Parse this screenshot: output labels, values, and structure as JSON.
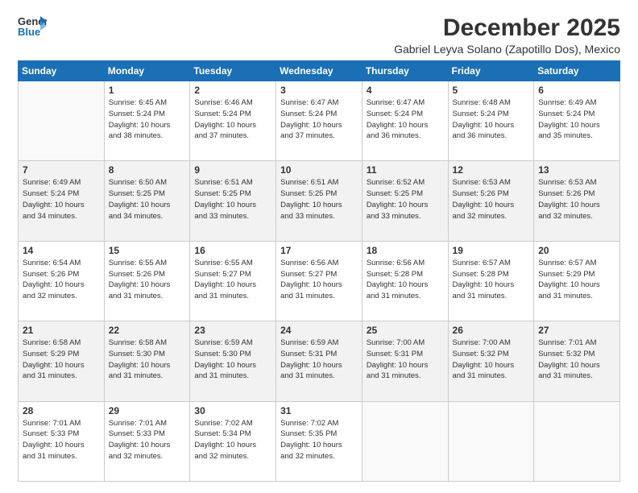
{
  "logo": {
    "line1": "General",
    "line2": "Blue"
  },
  "title": "December 2025",
  "subtitle": "Gabriel Leyva Solano (Zapotillo Dos), Mexico",
  "days_header": [
    "Sunday",
    "Monday",
    "Tuesday",
    "Wednesday",
    "Thursday",
    "Friday",
    "Saturday"
  ],
  "weeks": [
    [
      {
        "num": "",
        "info": ""
      },
      {
        "num": "1",
        "info": "Sunrise: 6:45 AM\nSunset: 5:24 PM\nDaylight: 10 hours\nand 38 minutes."
      },
      {
        "num": "2",
        "info": "Sunrise: 6:46 AM\nSunset: 5:24 PM\nDaylight: 10 hours\nand 37 minutes."
      },
      {
        "num": "3",
        "info": "Sunrise: 6:47 AM\nSunset: 5:24 PM\nDaylight: 10 hours\nand 37 minutes."
      },
      {
        "num": "4",
        "info": "Sunrise: 6:47 AM\nSunset: 5:24 PM\nDaylight: 10 hours\nand 36 minutes."
      },
      {
        "num": "5",
        "info": "Sunrise: 6:48 AM\nSunset: 5:24 PM\nDaylight: 10 hours\nand 36 minutes."
      },
      {
        "num": "6",
        "info": "Sunrise: 6:49 AM\nSunset: 5:24 PM\nDaylight: 10 hours\nand 35 minutes."
      }
    ],
    [
      {
        "num": "7",
        "info": "Sunrise: 6:49 AM\nSunset: 5:24 PM\nDaylight: 10 hours\nand 34 minutes."
      },
      {
        "num": "8",
        "info": "Sunrise: 6:50 AM\nSunset: 5:25 PM\nDaylight: 10 hours\nand 34 minutes."
      },
      {
        "num": "9",
        "info": "Sunrise: 6:51 AM\nSunset: 5:25 PM\nDaylight: 10 hours\nand 33 minutes."
      },
      {
        "num": "10",
        "info": "Sunrise: 6:51 AM\nSunset: 5:25 PM\nDaylight: 10 hours\nand 33 minutes."
      },
      {
        "num": "11",
        "info": "Sunrise: 6:52 AM\nSunset: 5:25 PM\nDaylight: 10 hours\nand 33 minutes."
      },
      {
        "num": "12",
        "info": "Sunrise: 6:53 AM\nSunset: 5:26 PM\nDaylight: 10 hours\nand 32 minutes."
      },
      {
        "num": "13",
        "info": "Sunrise: 6:53 AM\nSunset: 5:26 PM\nDaylight: 10 hours\nand 32 minutes."
      }
    ],
    [
      {
        "num": "14",
        "info": "Sunrise: 6:54 AM\nSunset: 5:26 PM\nDaylight: 10 hours\nand 32 minutes."
      },
      {
        "num": "15",
        "info": "Sunrise: 6:55 AM\nSunset: 5:26 PM\nDaylight: 10 hours\nand 31 minutes."
      },
      {
        "num": "16",
        "info": "Sunrise: 6:55 AM\nSunset: 5:27 PM\nDaylight: 10 hours\nand 31 minutes."
      },
      {
        "num": "17",
        "info": "Sunrise: 6:56 AM\nSunset: 5:27 PM\nDaylight: 10 hours\nand 31 minutes."
      },
      {
        "num": "18",
        "info": "Sunrise: 6:56 AM\nSunset: 5:28 PM\nDaylight: 10 hours\nand 31 minutes."
      },
      {
        "num": "19",
        "info": "Sunrise: 6:57 AM\nSunset: 5:28 PM\nDaylight: 10 hours\nand 31 minutes."
      },
      {
        "num": "20",
        "info": "Sunrise: 6:57 AM\nSunset: 5:29 PM\nDaylight: 10 hours\nand 31 minutes."
      }
    ],
    [
      {
        "num": "21",
        "info": "Sunrise: 6:58 AM\nSunset: 5:29 PM\nDaylight: 10 hours\nand 31 minutes."
      },
      {
        "num": "22",
        "info": "Sunrise: 6:58 AM\nSunset: 5:30 PM\nDaylight: 10 hours\nand 31 minutes."
      },
      {
        "num": "23",
        "info": "Sunrise: 6:59 AM\nSunset: 5:30 PM\nDaylight: 10 hours\nand 31 minutes."
      },
      {
        "num": "24",
        "info": "Sunrise: 6:59 AM\nSunset: 5:31 PM\nDaylight: 10 hours\nand 31 minutes."
      },
      {
        "num": "25",
        "info": "Sunrise: 7:00 AM\nSunset: 5:31 PM\nDaylight: 10 hours\nand 31 minutes."
      },
      {
        "num": "26",
        "info": "Sunrise: 7:00 AM\nSunset: 5:32 PM\nDaylight: 10 hours\nand 31 minutes."
      },
      {
        "num": "27",
        "info": "Sunrise: 7:01 AM\nSunset: 5:32 PM\nDaylight: 10 hours\nand 31 minutes."
      }
    ],
    [
      {
        "num": "28",
        "info": "Sunrise: 7:01 AM\nSunset: 5:33 PM\nDaylight: 10 hours\nand 31 minutes."
      },
      {
        "num": "29",
        "info": "Sunrise: 7:01 AM\nSunset: 5:33 PM\nDaylight: 10 hours\nand 32 minutes."
      },
      {
        "num": "30",
        "info": "Sunrise: 7:02 AM\nSunset: 5:34 PM\nDaylight: 10 hours\nand 32 minutes."
      },
      {
        "num": "31",
        "info": "Sunrise: 7:02 AM\nSunset: 5:35 PM\nDaylight: 10 hours\nand 32 minutes."
      },
      {
        "num": "",
        "info": ""
      },
      {
        "num": "",
        "info": ""
      },
      {
        "num": "",
        "info": ""
      }
    ]
  ]
}
